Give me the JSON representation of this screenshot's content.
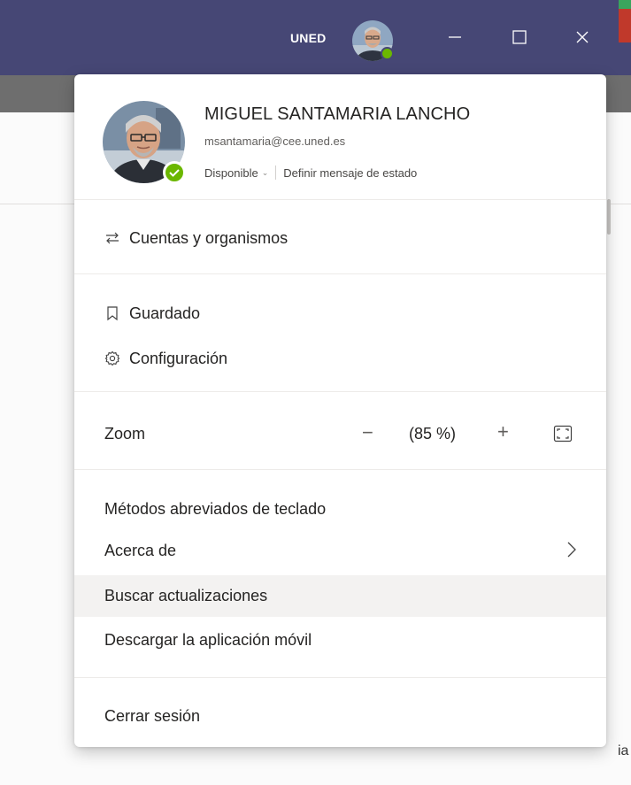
{
  "titlebar": {
    "org": "UNED",
    "colors": {
      "background": "#464775",
      "status": "#6bb700"
    }
  },
  "profile": {
    "name": "MIGUEL SANTAMARIA LANCHO",
    "email": "msantamaria@cee.uned.es",
    "availability": "Disponible",
    "set_status_message": "Definir mensaje de estado"
  },
  "menu": {
    "accounts": "Cuentas y organismos",
    "saved": "Guardado",
    "settings": "Configuración",
    "zoom": {
      "label": "Zoom",
      "minus": "−",
      "value": "(85 %)",
      "plus": "+"
    },
    "shortcuts": "Métodos abreviados de teclado",
    "about": "Acerca de",
    "check_updates": "Buscar actualizaciones",
    "download_mobile": "Descargar la aplicación móvil",
    "sign_out": "Cerrar sesión"
  },
  "background": {
    "edge_char": "ia"
  }
}
